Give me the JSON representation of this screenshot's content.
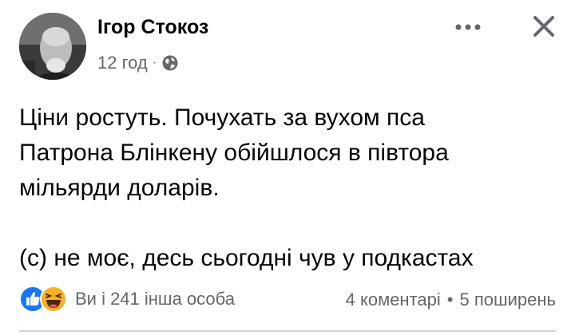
{
  "header": {
    "author": "Ігор Стокоз",
    "time": "12 год",
    "separator": "·",
    "privacy_icon": "globe-icon",
    "more_icon": "more-horizontal-icon",
    "close_icon": "close-icon"
  },
  "post": {
    "line1": "Ціни ростуть. Почухать за вухом пса",
    "line2": "Патрона Блінкену обійшлося в півтора",
    "line3": "мільярди доларів.",
    "line4": "(с) не моє, десь сьогодні чув у подкастах"
  },
  "footer": {
    "reaction_icons": [
      "like-icon",
      "haha-icon"
    ],
    "reactions_text": "Ви і 241 інша особа",
    "comments": "4 коментарі",
    "dot": "•",
    "shares": "5 поширень"
  },
  "colors": {
    "text": "#050505",
    "secondary": "#65676b",
    "like_blue": "#1877f2",
    "haha_yellow": "#f7b125"
  }
}
